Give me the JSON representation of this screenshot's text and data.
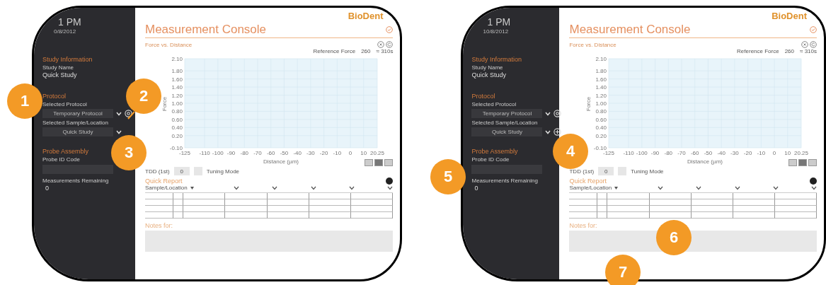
{
  "panels": [
    {
      "time": "1 PM",
      "date": "0/8/2012",
      "study_information": {
        "heading": "Study Information",
        "label": "Study Name",
        "value": "Quick Study"
      },
      "protocol": {
        "heading": "Protocol",
        "protocol_label": "Selected Protocol",
        "protocol_value": "Temporary Protocol",
        "sample_label": "Selected Sample/Location",
        "sample_value": "Quick Study"
      },
      "probe_assembly": {
        "heading": "Probe Assembly",
        "id_label": "Probe ID Code",
        "remaining_label": "Measurements Remaining",
        "remaining_value": "0"
      },
      "logo": "BioDent",
      "title": "Measurement Console",
      "chart": {
        "title": "Force vs. Distance",
        "reference_label": "Reference Force",
        "reference_value": "260",
        "duration": "≈ 310s",
        "chart_data": {
          "type": "line",
          "grid": true,
          "xlabel": "Distance (µm)",
          "ylabel": "Force",
          "xlim": [
            -125,
            20.25
          ],
          "ylim": [
            -0.1,
            2.1
          ],
          "xticks": [
            -125,
            -110,
            -100,
            -90,
            -80,
            -70,
            -60,
            -50,
            -40,
            -30,
            -20,
            -10,
            0,
            10,
            {
              "value": 20.25,
              "label": "20.25"
            }
          ],
          "yticks": [
            {
              "value": 2.1,
              "label": "2.10"
            },
            {
              "value": 1.8,
              "label": "1.80"
            },
            {
              "value": 1.6,
              "label": "1.60"
            },
            {
              "value": 1.4,
              "label": "1.40"
            },
            {
              "value": 1.2,
              "label": "1.20"
            },
            {
              "value": 1,
              "label": "1.00"
            },
            {
              "value": 0.8,
              "label": "0.80"
            },
            {
              "value": 0.6,
              "label": "0.60"
            },
            {
              "value": 0.4,
              "label": "0.40"
            },
            {
              "value": 0.2,
              "label": "0.20"
            },
            {
              "value": -0.1,
              "label": "-0.10"
            }
          ]
        }
      },
      "tdd": {
        "label": "TDD (1st)",
        "value": "0"
      },
      "tuning_mode": {
        "label": "Tuning Mode",
        "checked": false
      },
      "quick_report": {
        "title": "Quick Report",
        "first_column": "Sample/Location"
      },
      "notes": {
        "label": "Notes for:"
      },
      "callouts": [
        {
          "number": "1"
        },
        {
          "number": "2"
        },
        {
          "number": "3"
        }
      ]
    },
    {
      "time": "1 PM",
      "date": "10/8/2012",
      "study_information": {
        "heading": "Study Information",
        "label": "Study Name",
        "value": "Quick Study"
      },
      "protocol": {
        "heading": "Protocol",
        "protocol_label": "Selected Protocol",
        "protocol_value": "Temporary Protocol",
        "sample_label": "Selected Sample/Location",
        "sample_value": "Quick Study",
        "sample_buttons": [
          {
            "kind": "add"
          }
        ]
      },
      "probe_assembly": {
        "heading": "Probe Assembly",
        "id_label": "Probe ID Code",
        "remaining_label": "Measurements Remaining",
        "remaining_value": "0"
      },
      "logo": "BioDent",
      "title": "Measurement Console",
      "chart": {
        "title": "Force vs. Distance",
        "reference_label": "Reference Force",
        "reference_value": "260",
        "duration": "≈ 310s",
        "chart_data": {
          "type": "line",
          "grid": true,
          "xlabel": "Distance (µm)",
          "ylabel": "Force",
          "xlim": [
            -125,
            20.25
          ],
          "ylim": [
            -0.1,
            2.1
          ],
          "xticks": [
            -125,
            -110,
            -100,
            -90,
            -80,
            -70,
            -60,
            -50,
            -40,
            -30,
            -20,
            -10,
            0,
            10,
            {
              "value": 20.25,
              "label": "20.25"
            }
          ],
          "yticks": [
            {
              "value": 2.1,
              "label": "2.10"
            },
            {
              "value": 1.8,
              "label": "1.80"
            },
            {
              "value": 1.6,
              "label": "1.60"
            },
            {
              "value": 1.4,
              "label": "1.40"
            },
            {
              "value": 1.2,
              "label": "1.20"
            },
            {
              "value": 1,
              "label": "1.00"
            },
            {
              "value": 0.8,
              "label": "0.80"
            },
            {
              "value": 0.6,
              "label": "0.60"
            },
            {
              "value": 0.4,
              "label": "0.40"
            },
            {
              "value": 0.2,
              "label": "0.20"
            },
            {
              "value": -0.1,
              "label": "-0.10"
            }
          ]
        }
      },
      "tdd": {
        "label": "TDD (1st)",
        "value": "0"
      },
      "tuning_mode": {
        "label": "Tuning Mode",
        "checked": false
      },
      "quick_report": {
        "title": "Quick Report",
        "first_column": "Sample/Location"
      },
      "notes": {
        "label": "Notes for:"
      },
      "callouts": [
        {
          "number": "4"
        },
        {
          "number": "5"
        },
        {
          "number": "6"
        },
        {
          "number": "7"
        }
      ]
    }
  ]
}
